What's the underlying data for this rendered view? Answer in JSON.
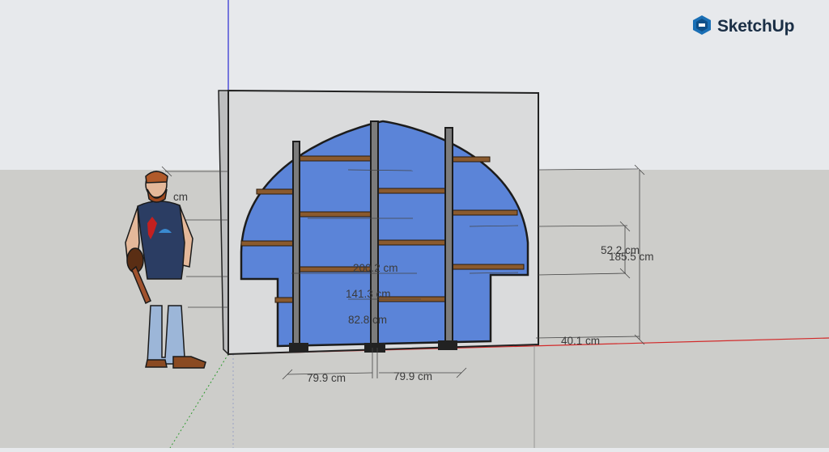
{
  "app": {
    "brand": "SketchUp",
    "brand_icon": "sketchup-logo-icon"
  },
  "colors": {
    "sky": "#e7e9ec",
    "ground": "#cdcdca",
    "wall": "#dadbdc",
    "opening": "#5b84d8",
    "shelf": "#8a5a2e",
    "upright": "#7c7c7c",
    "x_axis": "#d22a2a",
    "y_axis": "#2f9a2f",
    "z_axis": "#2a2ad2"
  },
  "dimensions": {
    "person_height_partial": "cm",
    "shelf_height_1": "200.2 cm",
    "shelf_height_2": "141.3 cm",
    "shelf_height_3": "82.8 cm",
    "right_height_total": "185.5 cm",
    "right_height_upper": "52.2 cm",
    "right_base": "40.1 cm",
    "bay_width_left": "79.9 cm",
    "bay_width_right": "79.9 cm"
  }
}
